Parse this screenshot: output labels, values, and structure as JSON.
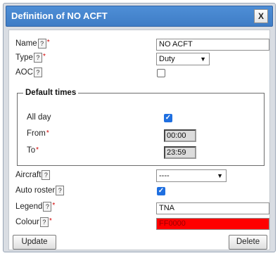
{
  "dialog": {
    "title": "Definition of NO ACFT",
    "close_label": "X"
  },
  "help_glyph": "?",
  "required_mark": "*",
  "fields": {
    "name": {
      "label": "Name",
      "value": "NO ACFT"
    },
    "type": {
      "label": "Type",
      "value": "Duty"
    },
    "aoc": {
      "label": "AOC",
      "checked": false
    },
    "default_times": {
      "legend": "Default times",
      "all_day": {
        "label": "All day",
        "checked": true
      },
      "from": {
        "label": "From",
        "value": "00:00"
      },
      "to": {
        "label": "To",
        "value": "23:59"
      }
    },
    "aircraft": {
      "label": "Aircraft",
      "value": "----"
    },
    "auto_roster": {
      "label": "Auto roster",
      "checked": true
    },
    "legend": {
      "label": "Legend",
      "value": "TNA"
    },
    "colour": {
      "label": "Colour",
      "value": "FF0000",
      "swatch": "#ff0000"
    }
  },
  "buttons": {
    "update": "Update",
    "delete": "Delete"
  },
  "colors": {
    "titlebar": "#4a89d2",
    "checkbox_checked": "#1f6fe0",
    "required": "#d00000"
  }
}
